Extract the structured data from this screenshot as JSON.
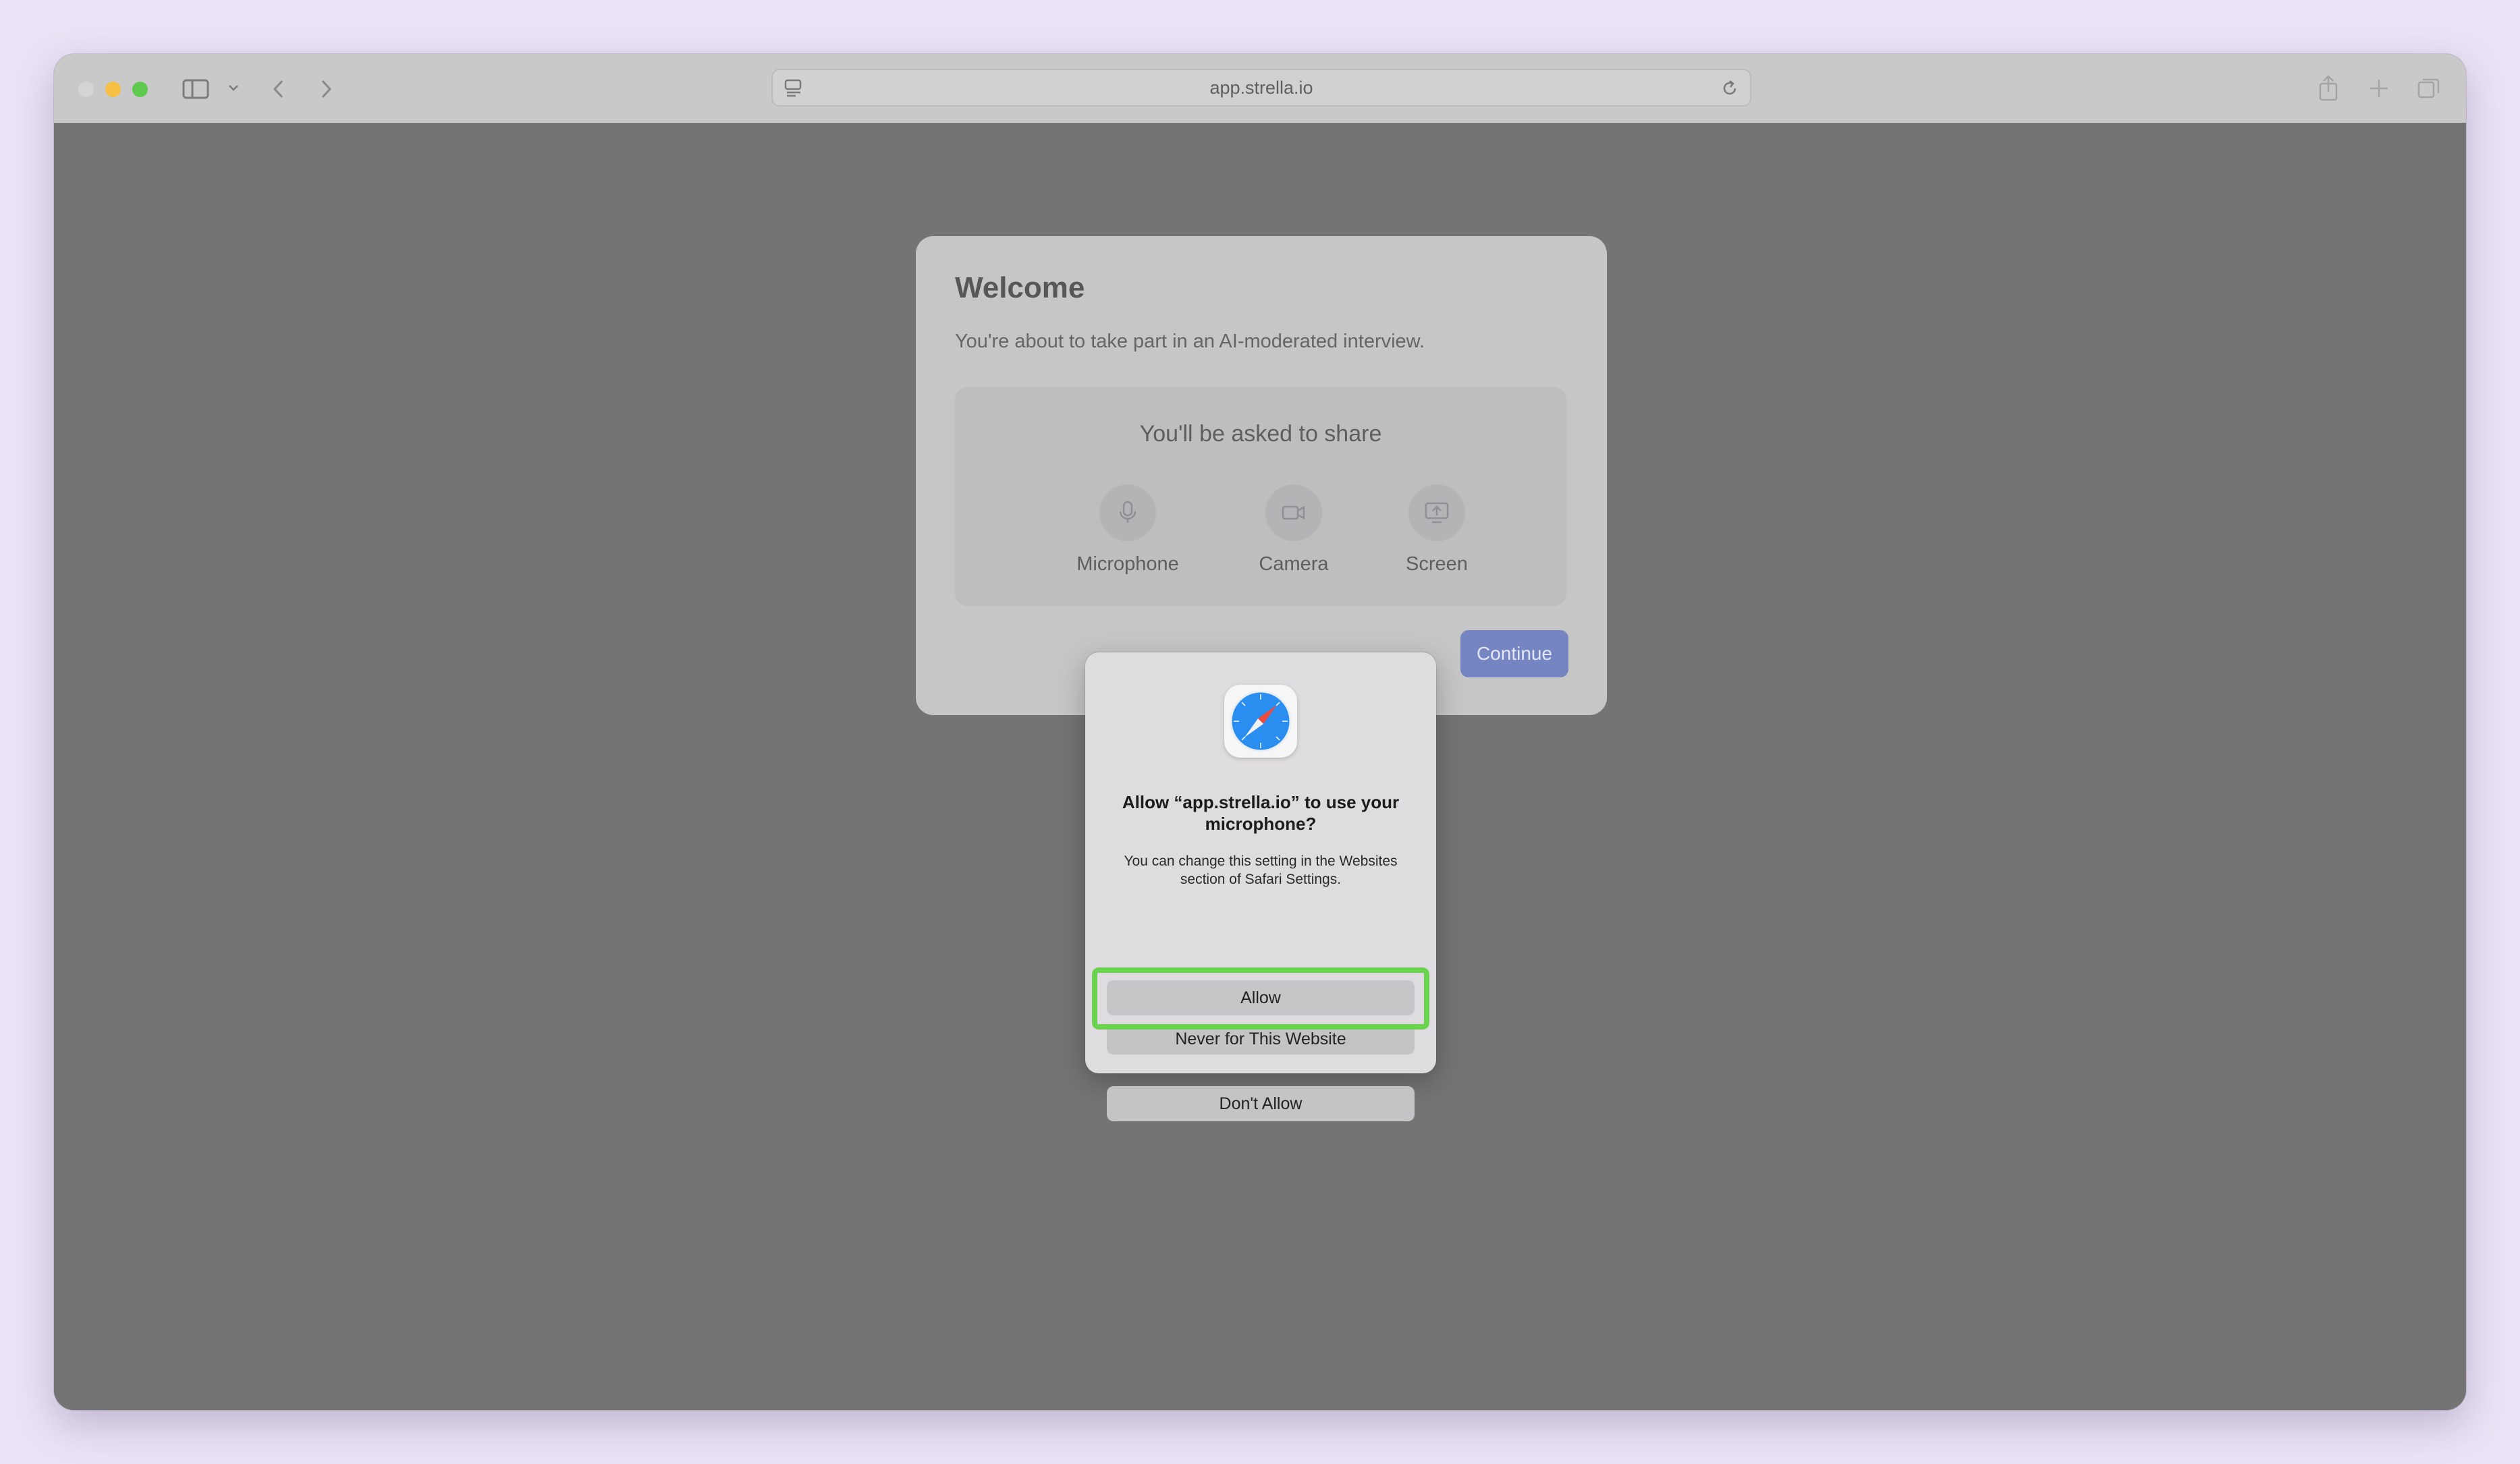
{
  "browser": {
    "url": "app.strella.io",
    "traffic_lights": [
      "#d4d4d4",
      "#f5c043",
      "#5fca4f"
    ],
    "icons": [
      "sidebar-icon",
      "chevron-down-icon",
      "back-icon",
      "forward-icon",
      "site-settings-icon",
      "reload-icon",
      "share-icon",
      "new-tab-icon",
      "tab-overview-icon"
    ]
  },
  "welcome": {
    "title": "Welcome",
    "subtitle": "You're about to take part in an AI-moderated interview.",
    "share_heading": "You'll be asked to share",
    "permissions": [
      {
        "label": "Microphone",
        "icon": "microphone-icon"
      },
      {
        "label": "Camera",
        "icon": "camera-icon"
      },
      {
        "label": "Screen",
        "icon": "screen-share-icon"
      }
    ],
    "continue_label": "Continue"
  },
  "dialog": {
    "icon": "safari-icon",
    "title": "Allow “app.strella.io” to use your microphone?",
    "body": "You can change this setting in the Websites section of Safari Settings.",
    "buttons": {
      "allow": "Allow",
      "never": "Never for This Website",
      "deny": "Don't Allow"
    },
    "highlight_color": "#6ad24f"
  }
}
